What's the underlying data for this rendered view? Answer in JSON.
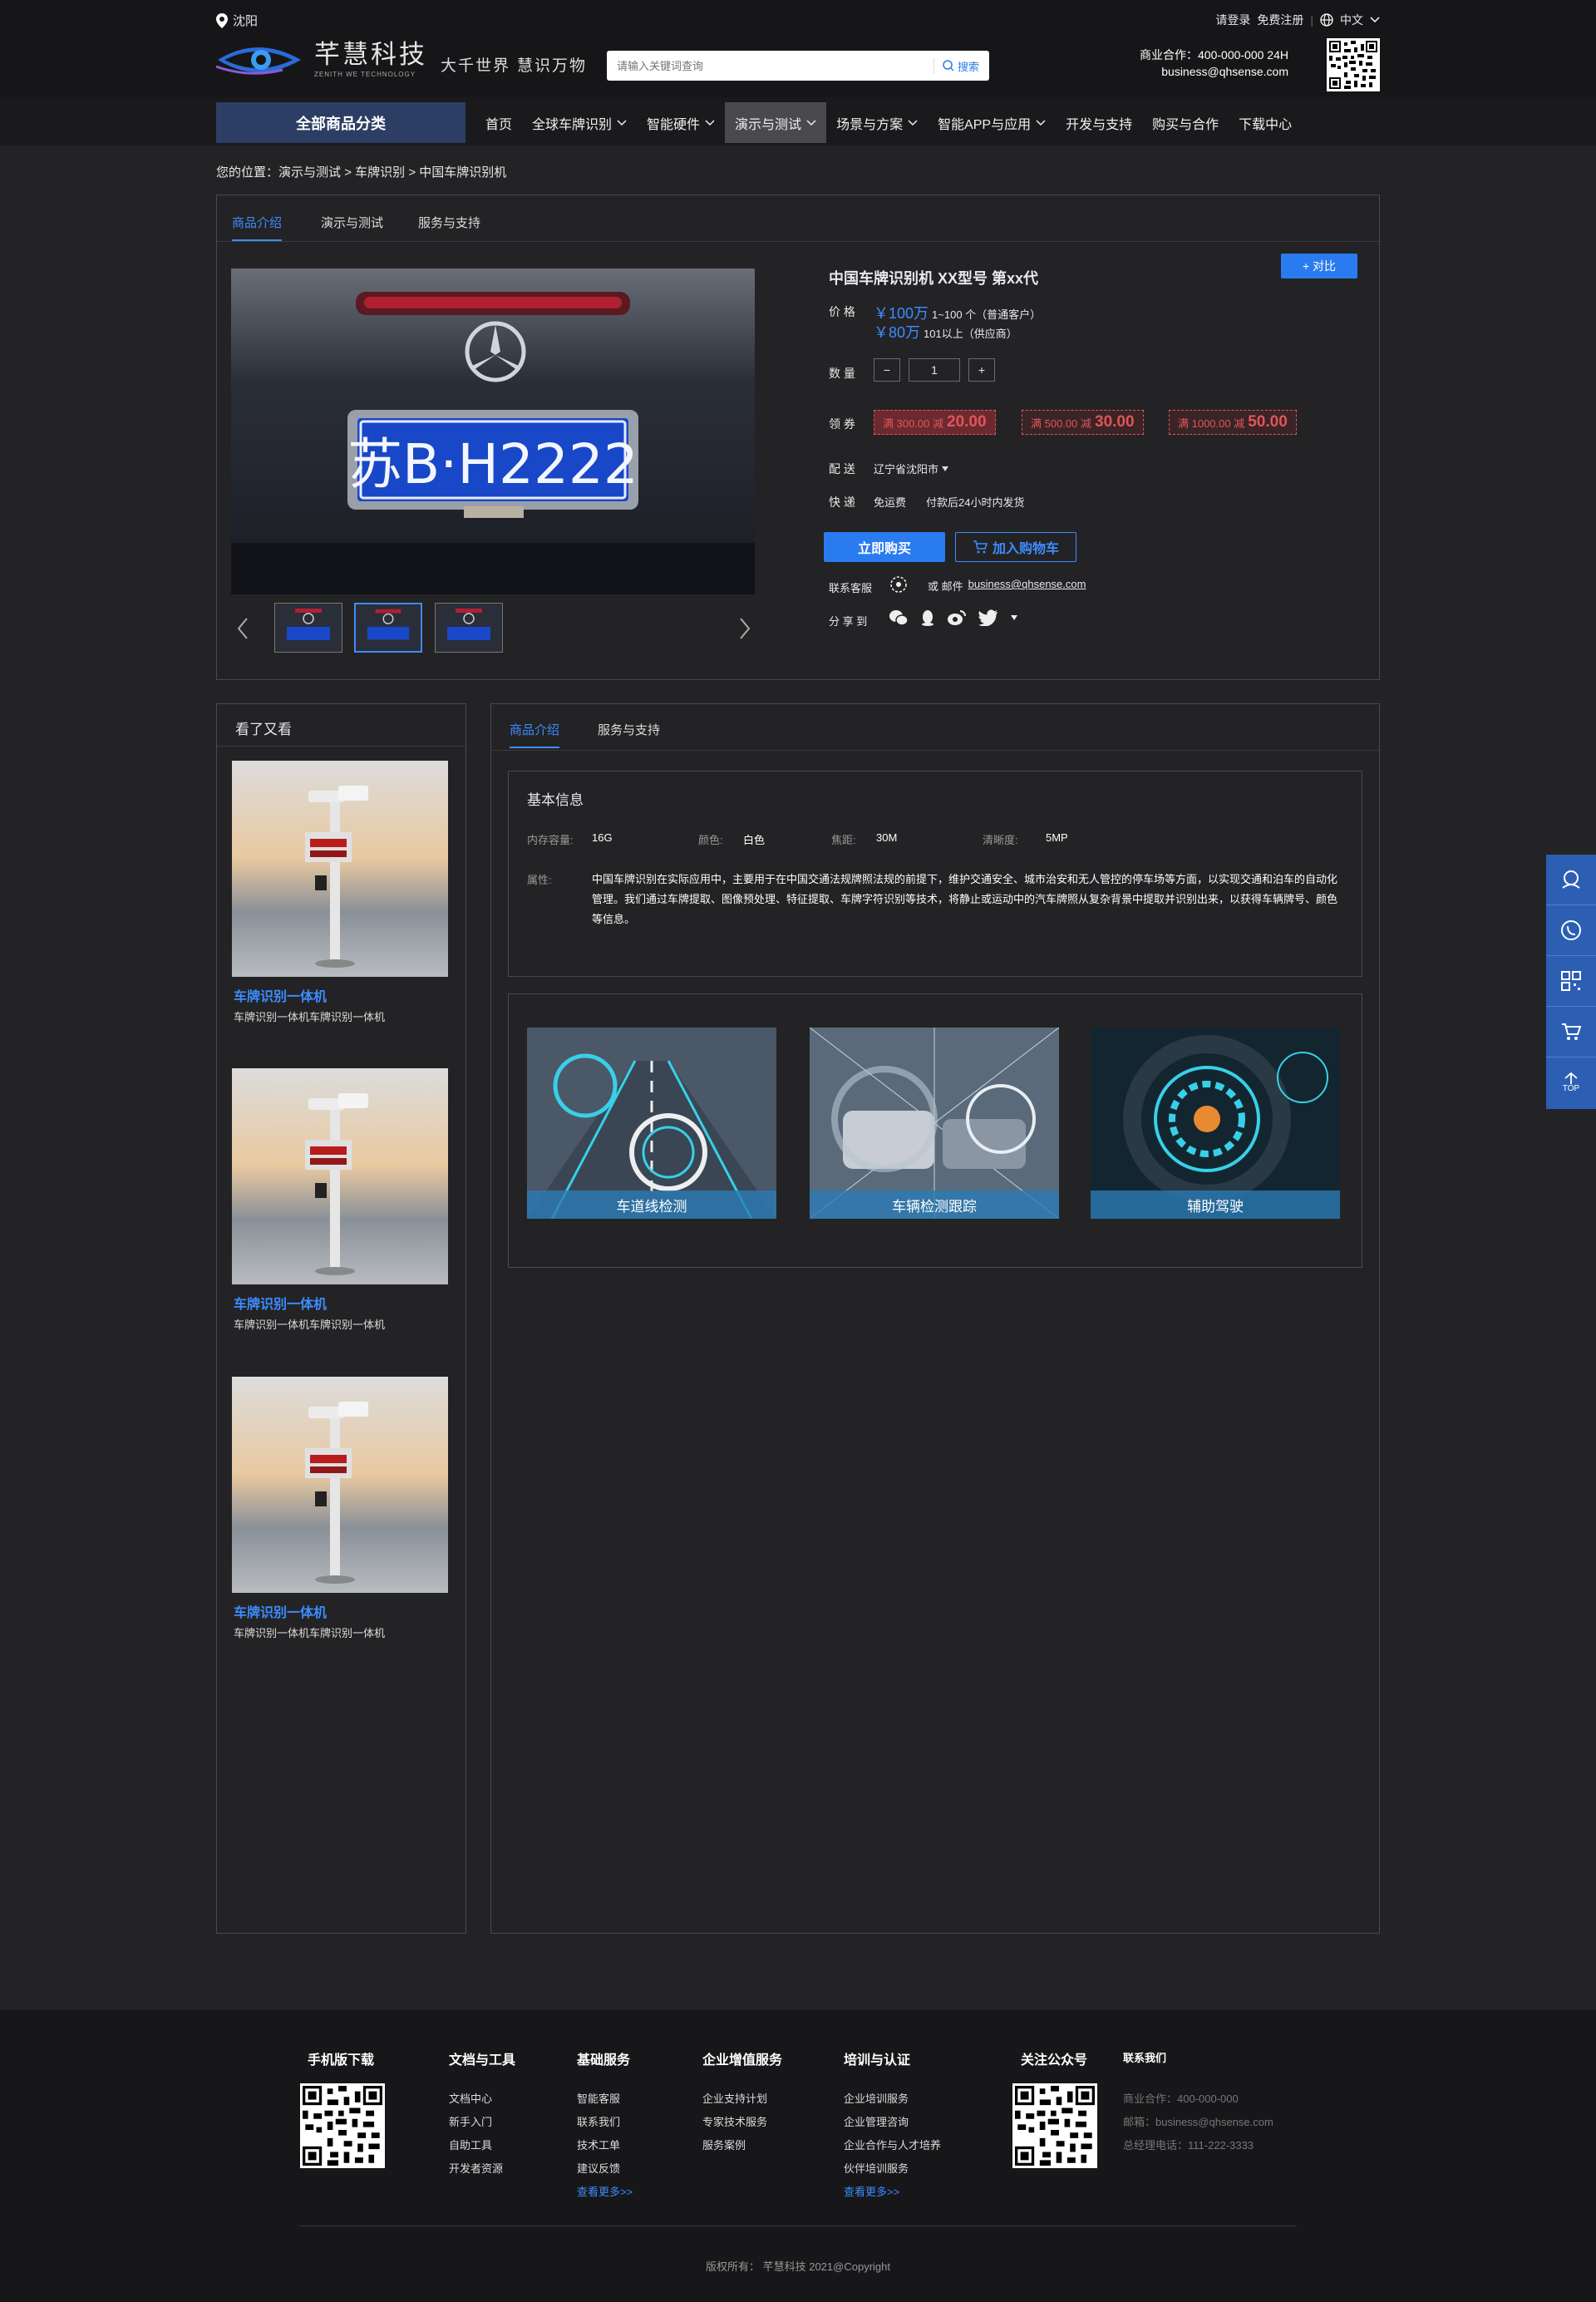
{
  "header": {
    "location": "沈阳",
    "login": "请登录",
    "register": "免费注册",
    "lang": "中文",
    "brand_name": "芊慧科技",
    "brand_sub": "ZENITH WE TECHNOLOGY",
    "slogan": "大千世界 慧识万物",
    "search_placeholder": "请输入关键词查询",
    "search_button": "搜索",
    "contact_line1": "商业合作：400-000-000 24H",
    "contact_line2": "business@qhsense.com"
  },
  "nav": {
    "category": "全部商品分类",
    "items": [
      {
        "label": "首页",
        "dropdown": false
      },
      {
        "label": "全球车牌识别",
        "dropdown": true
      },
      {
        "label": "智能硬件",
        "dropdown": true
      },
      {
        "label": "演示与测试",
        "dropdown": true,
        "active": true
      },
      {
        "label": "场景与方案",
        "dropdown": true
      },
      {
        "label": "智能APP与应用",
        "dropdown": true
      },
      {
        "label": "开发与支持",
        "dropdown": false
      },
      {
        "label": "购买与合作",
        "dropdown": false
      },
      {
        "label": "下载中心",
        "dropdown": false
      }
    ]
  },
  "breadcrumb": {
    "prefix": "您的位置：",
    "l1": "演示与测试",
    "l2": "车牌识别",
    "l3": "中国车牌识别机",
    "sep": ">"
  },
  "product": {
    "tabs": [
      "商品介绍",
      "演示与测试",
      "服务与支持"
    ],
    "title": "中国车牌识别机 XX型号 第xx代",
    "compare": "+ 对比",
    "plate_text": "苏B·H2222",
    "price_label": "价 格",
    "price1": "￥100万",
    "price1_note": "1~100 个（普通客户）",
    "price2": "￥80万",
    "price2_note": "101以上（供应商）",
    "qty_label": "数 量",
    "qty": "1",
    "qty_minus": "−",
    "qty_plus": "+",
    "coupon_label": "领 券",
    "coupons": [
      {
        "cond": "满 300.00 减",
        "amount": "20.00"
      },
      {
        "cond": "满 500.00 减",
        "amount": "30.00"
      },
      {
        "cond": "满 1000.00 减",
        "amount": "50.00"
      }
    ],
    "delivery_label": "配 送",
    "delivery_value": "辽宁省沈阳市",
    "express_label": "快 递",
    "express_fee": "免运费",
    "express_note": "付款后24小时内发货",
    "buy_now": "立即购买",
    "add_cart": "加入购物车",
    "service_label": "联系客服",
    "mail_or": "或 邮件",
    "mail": "business@qhsense.com",
    "share_label": "分 享 到"
  },
  "related": {
    "title": "看了又看",
    "items": [
      {
        "name": "车牌识别一体机",
        "desc": "车牌识别一体机车牌识别一体机"
      },
      {
        "name": "车牌识别一体机",
        "desc": "车牌识别一体机车牌识别一体机"
      },
      {
        "name": "车牌识别一体机",
        "desc": "车牌识别一体机车牌识别一体机"
      }
    ]
  },
  "detail": {
    "tabs": [
      "商品介绍",
      "服务与支持"
    ],
    "basic_title": "基本信息",
    "specs": [
      {
        "k": "内存容量:",
        "v": "16G"
      },
      {
        "k": "颜色:",
        "v": "白色"
      },
      {
        "k": "焦距:",
        "v": "30M"
      },
      {
        "k": "清晰度:",
        "v": "5MP"
      }
    ],
    "attr_label": "属性:",
    "attr_text": "中国车牌识别在实际应用中，主要用于在中国交通法规牌照法规的前提下，维护交通安全、城市治安和无人管控的停车场等方面，以实现交通和泊车的自动化管理。我们通过车牌提取、图像预处理、特征提取、车牌字符识别等技术，将静止或运动中的汽车牌照从复杂背景中提取并识别出来，以获得车辆牌号、颜色等信息。",
    "scenes": [
      "车道线检测",
      "车辆检测跟踪",
      "辅助驾驶"
    ]
  },
  "float_bar": {
    "top_label": "TOP"
  },
  "footer": {
    "cols": [
      {
        "title": "手机版下载",
        "links": []
      },
      {
        "title": "文档与工具",
        "links": [
          "文档中心",
          "新手入门",
          "自助工具",
          "开发者资源"
        ]
      },
      {
        "title": "基础服务",
        "links": [
          "智能客服",
          "联系我们",
          "技术工单",
          "建议反馈"
        ],
        "more": "查看更多>>"
      },
      {
        "title": "企业增值服务",
        "links": [
          "企业支持计划",
          "专家技术服务",
          "服务案例"
        ]
      },
      {
        "title": "培训与认证",
        "links": [
          "企业培训服务",
          "企业管理咨询",
          "企业合作与人才培养",
          "伙伴培训服务"
        ],
        "more": "查看更多>>"
      },
      {
        "title": "关注公众号",
        "links": []
      }
    ],
    "contact_title": "联系我们",
    "contact_lines": [
      "商业合作：400-000-000",
      "邮箱：business@qhsense.com",
      "总经理电话：111-222-3333"
    ],
    "copyright": "版权所有： 芊慧科技 2021@Copyright"
  },
  "colors": {
    "accent": "#3c8cff",
    "coupon": "#e0555a",
    "nav_category": "#2c3e64",
    "float_bar": "#2c5fb4"
  }
}
